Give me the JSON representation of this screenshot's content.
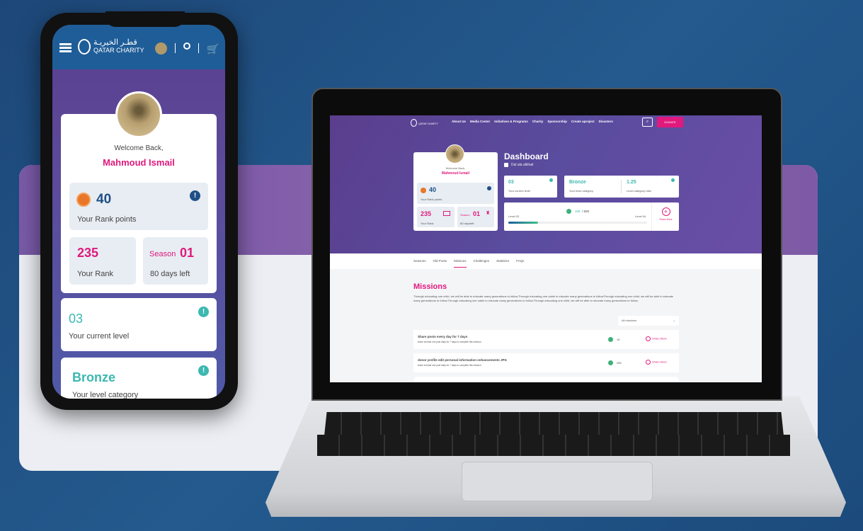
{
  "brand": {
    "name_en": "QATAR CHARITY",
    "name_ar": "قطـر الخيريـة"
  },
  "colors": {
    "accent_pink": "#e0197d",
    "teal": "#3cb8b0",
    "header_blue": "#1f5d98",
    "purple": "#5b3e8e"
  },
  "phone": {
    "icons": [
      "menu-icon",
      "search-icon",
      "cart-icon"
    ],
    "welcome": "Welcome Back,",
    "user_name": "Mahmoud Ismail",
    "rank_points": "40",
    "rank_points_label": "Your Rank points",
    "rank": "235",
    "rank_label": "Your Rank",
    "season_label": "Season",
    "season": "01",
    "days_left": "80 days left",
    "level": "03",
    "level_label": "Your current level",
    "category": "Bronze",
    "category_label": "Your level category"
  },
  "laptop": {
    "nav": [
      "About Us",
      "Media Center",
      "Initiatives & Programs",
      "Charity",
      "Sponsorship",
      "Create aproject",
      "Disasters"
    ],
    "donate": "DONATE",
    "welcome": "Welcome Back,",
    "user_name": "Mahmoud Ismail",
    "rank_points": "40",
    "rank_points_label": "Your Rank points",
    "rank": "235",
    "rank_label": "Your Rank",
    "season_label": "Season",
    "season": "01",
    "days_left": "80 daysleft",
    "title": "Dashboard",
    "subtitle": "Dal ala alkhair",
    "level": "03",
    "level_label": "Your current level",
    "category": "Bronze",
    "category_label": "Your level category",
    "ratio": "1.25",
    "ratio_label": "Level category ratio",
    "progress": {
      "current": "108",
      "total": "/ 500",
      "value": 108,
      "max": 500,
      "from": "Level 03",
      "to": "Level 04"
    },
    "share_more": "Share More",
    "tabs": [
      "Seasons",
      "Old Posts",
      "Missions",
      "Challenges",
      "Statistics",
      "FAQs"
    ],
    "active_tab": "Missions",
    "missions_title": "Missions",
    "missions_desc": "Through educating one child, we will be able to educate many generations to follow.Through educating one cable to educate many generations to followThrough educating one child, we will be able to educate many generations to follow.Through educating one cable to educate many generations to follow.Through educating one child, we will be able to educate many generations to follow.",
    "filter": "All missions",
    "missions": [
      {
        "title": "Share posts every day for 7 days",
        "desc": "share at least one post daily for 7 days to complete this mission.",
        "points": "10",
        "action": "Share More"
      },
      {
        "title": "donor profile edit personal information enhancements JPG",
        "desc": "share at least one post daily for 7 days to complete this mission.",
        "points": "290",
        "action": "Share More"
      }
    ]
  }
}
